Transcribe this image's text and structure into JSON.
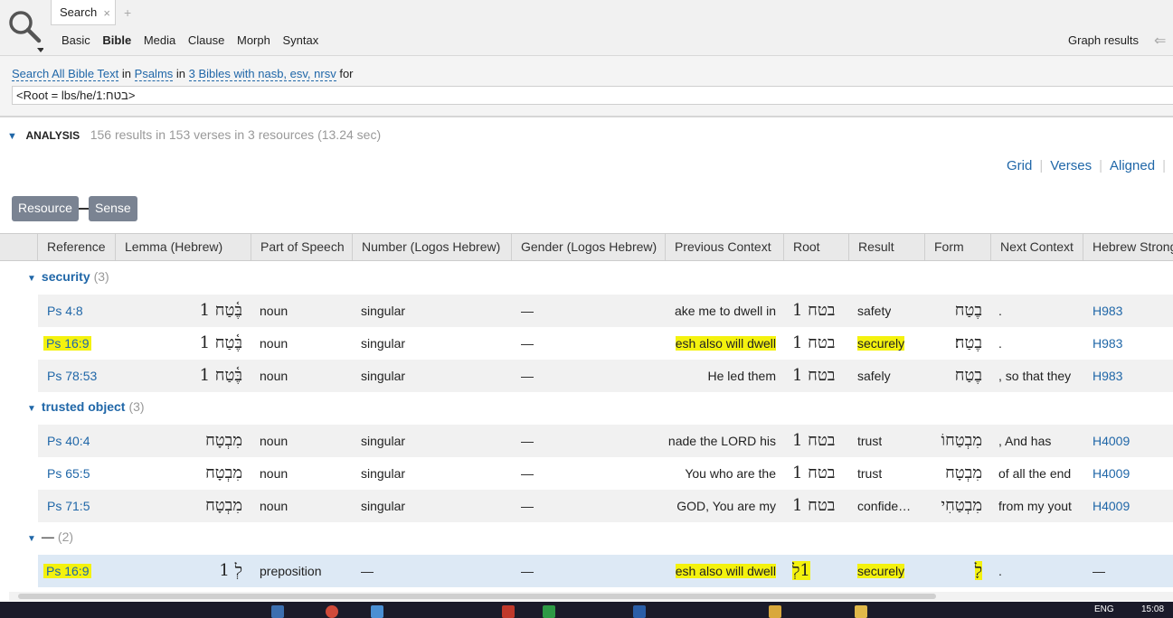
{
  "tab": {
    "label": "Search",
    "close": "×",
    "new": "+"
  },
  "modes": [
    "Basic",
    "Bible",
    "Media",
    "Clause",
    "Morph",
    "Syntax"
  ],
  "graph_label": "Graph results",
  "scope": {
    "search_text": "Search All Bible Text",
    "in1": "in",
    "range": "Psalms",
    "in2": "in",
    "bibles": "3 Bibles with nasb, esv, nrsv",
    "for": "for"
  },
  "query": "<Root = lbs/he/1:בטח>",
  "analysis": {
    "title": "ANALYSIS",
    "summary": "156 results in 153 verses in 3 resources (13.24 sec)"
  },
  "views": [
    "Grid",
    "Verses",
    "Aligned",
    "A"
  ],
  "pills": [
    "Resource",
    "Sense"
  ],
  "columns": [
    "Reference",
    "Lemma (Hebrew)",
    "Part of Speech",
    "Number (Logos Hebrew)",
    "Gender (Logos Hebrew)",
    "Previous Context",
    "Root",
    "Result",
    "Form",
    "Next Context",
    "Hebrew Strong"
  ],
  "groups": [
    {
      "name": "security",
      "count": "(3)",
      "rows": [
        {
          "ref": "Ps 4:8",
          "lemma": "בֶּ֫טַח 1",
          "pos": "noun",
          "number": "singular",
          "gender": "—",
          "prev": "ake me to dwell in",
          "root": "בטח 1",
          "result": "safety",
          "form": "בֶטַח",
          "next": ".",
          "strong": "H983"
        },
        {
          "ref": "Ps 16:9",
          "lemma": "בֶּ֫טַח 1",
          "pos": "noun",
          "number": "singular",
          "gender": "—",
          "prev": "esh also will dwell",
          "root": "בטח 1",
          "result": "securely",
          "form": "בֶטַח׃",
          "next": ".",
          "strong": "H983"
        },
        {
          "ref": "Ps 78:53",
          "lemma": "בֶּ֫טַח 1",
          "pos": "noun",
          "number": "singular",
          "gender": "—",
          "prev": "He led them",
          "root": "בטח 1",
          "result": "safely",
          "form": "בֶטַח",
          "next": ", so that they",
          "strong": "H983"
        }
      ]
    },
    {
      "name": "trusted object",
      "count": "(3)",
      "rows": [
        {
          "ref": "Ps 40:4",
          "lemma": "מִבְטָח",
          "pos": "noun",
          "number": "singular",
          "gender": "—",
          "prev": "nade the LORD his",
          "root": "בטח 1",
          "result": "trust",
          "form": "מִבְטַחוֹ",
          "next": ",        And has",
          "strong": "H4009"
        },
        {
          "ref": "Ps 65:5",
          "lemma": "מִבְטָח",
          "pos": "noun",
          "number": "singular",
          "gender": "—",
          "prev": "You who are the",
          "root": "בטח 1",
          "result": "trust",
          "form": "מִבְטָח",
          "next": "of all the end",
          "strong": "H4009"
        },
        {
          "ref": "Ps 71:5",
          "lemma": "מִבְטָח",
          "pos": "noun",
          "number": "singular",
          "gender": "—",
          "prev": "GOD, You are my",
          "root": "בטח 1",
          "result": "confide…",
          "form": "מִבְטַחִי",
          "next": "from my yout",
          "strong": "H4009"
        }
      ]
    },
    {
      "name": "—",
      "count": "(2)",
      "rows": [
        {
          "ref": "Ps 16:9",
          "lemma": "לְ 1",
          "pos": "preposition",
          "number": "—",
          "gender": "—",
          "prev": "esh also will dwell",
          "root": "1לְ",
          "result": "securely",
          "form": "לָ",
          "next": ".",
          "strong": "—"
        }
      ]
    }
  ],
  "status": {
    "lang": "ENG",
    "time": "15:08"
  }
}
